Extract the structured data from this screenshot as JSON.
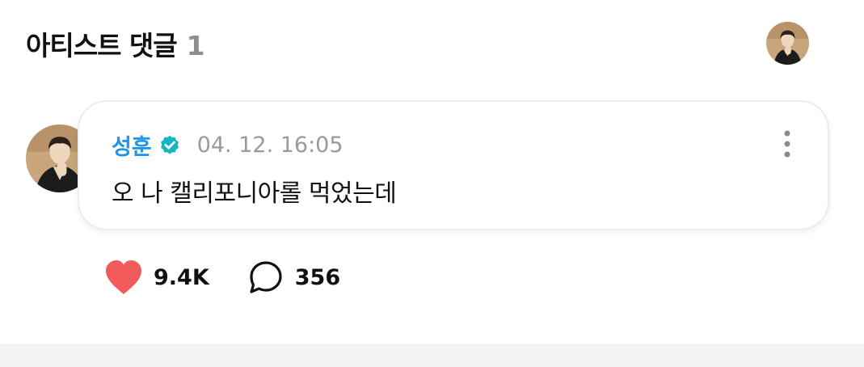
{
  "header": {
    "title": "아티스트 댓글",
    "count": "1",
    "avatar_icon": "artist-avatar"
  },
  "comment": {
    "author": "성훈",
    "verified_icon": "verified-badge-icon",
    "verified_color": "#16b6c0",
    "author_color": "#1f95e6",
    "timestamp": "04. 12. 16:05",
    "text": "오 나 캘리포니아롤 먹었는데",
    "more_icon": "more-vertical-icon"
  },
  "actions": {
    "likes": "9.4K",
    "like_icon": "heart-icon",
    "like_color": "#f25b5b",
    "replies": "356",
    "reply_icon": "speech-bubble-icon"
  }
}
